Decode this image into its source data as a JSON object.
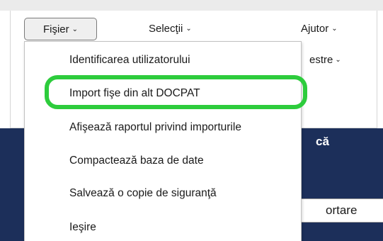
{
  "menubar": {
    "file": {
      "label": "Fişier",
      "chevron": "⌄"
    },
    "selections": {
      "label": "Selecţii",
      "chevron": "⌄"
    },
    "help": {
      "label": "Ajutor",
      "chevron": "⌄"
    },
    "registers": {
      "label": "estre",
      "chevron": "⌄"
    }
  },
  "file_menu": {
    "items": [
      "Identificarea utilizatorului",
      "Import fişe din alt DOCPAT",
      "Afişează raportul privind importurile",
      "Compactează baza de date",
      "Salvează o copie de siguranţă",
      "Ieşire"
    ],
    "highlighted_index": 1,
    "highlight_color": "#2dcc3c"
  },
  "background": {
    "heading_fragment": "că",
    "sort_button": "ortare",
    "navy_color": "#1c2f5a"
  }
}
